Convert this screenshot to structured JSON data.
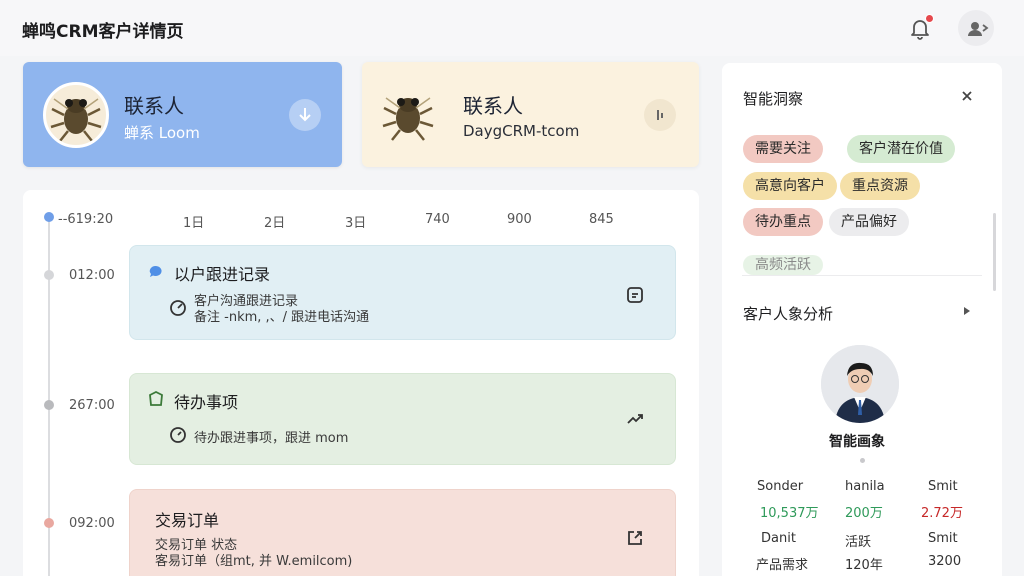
{
  "header": {
    "title": "蝉鸣CRM客户详情页",
    "icons": {
      "notification": "bell-icon",
      "user": "user-switch-icon"
    }
  },
  "contact_cards": [
    {
      "name": "联系人",
      "subtitle": "蝉系  Loom",
      "action_icon": "download-icon",
      "color": "#8fb5ee"
    },
    {
      "name": "联系人",
      "subtitle": "DaygCRM-tcom",
      "action_icon": "pause-icon",
      "color": "#fbf2df"
    }
  ],
  "timeline": {
    "scale": {
      "start": "--619:20",
      "ticks": [
        "1日",
        "2日",
        "3日",
        "740",
        "900",
        "845"
      ]
    },
    "events": [
      {
        "time": "012:00",
        "title": "以户跟进记录",
        "lines": [
          "客户沟通跟进记录",
          "备注 -nkm, ,、/ 跟进电话沟通"
        ],
        "icon": "chat-bubble-icon",
        "action_icon": "document-icon"
      },
      {
        "time": "267:00",
        "title": "待办事项",
        "lines": [
          "待办跟进事项，跟进 mom"
        ],
        "icon": "task-icon",
        "action_icon": "trend-up-icon"
      },
      {
        "time": "092:00",
        "title": "交易订单",
        "lines": [
          "交易订单 状态",
          "客易订单（组mt, 并 W.emilcom)"
        ],
        "icon": "order-icon",
        "action_icon": "external-link-icon"
      }
    ]
  },
  "side_panel": {
    "insights": {
      "title": "智能洞察",
      "close_icon": "close-icon",
      "tags": [
        {
          "label": "需要关注",
          "color": "#f2c9c2"
        },
        {
          "label": "客户潜在价值",
          "color": "#d5ebd2"
        },
        {
          "label": "高意向客户",
          "color": "#f5e0a8"
        },
        {
          "label": "重点资源",
          "color": "#f5e0a8"
        },
        {
          "label": "待办重点",
          "color": "#f2c9c2"
        },
        {
          "label": "产品偏好",
          "color": "#ececee"
        },
        {
          "label": "高频活跃",
          "color": "#d5ebd2"
        }
      ]
    },
    "profile": {
      "title": "客户人象分析",
      "arrow_icon": "chevron-right-icon",
      "portrait_label": "智能画象",
      "stats": [
        {
          "label": "Sonder",
          "value": "10,537万",
          "color": "#2f9a5a"
        },
        {
          "label": "hanila",
          "value": "200万",
          "color": "#2f9a5a"
        },
        {
          "label": "Smit",
          "value": "2.72万",
          "color": "#c62828"
        },
        {
          "label": "Danit",
          "value": "产品需求",
          "color": "#333333"
        },
        {
          "label": "活跃",
          "value": "120年",
          "color": "#333333"
        },
        {
          "label": "Smit",
          "value": "3200",
          "color": "#333333"
        }
      ]
    }
  }
}
